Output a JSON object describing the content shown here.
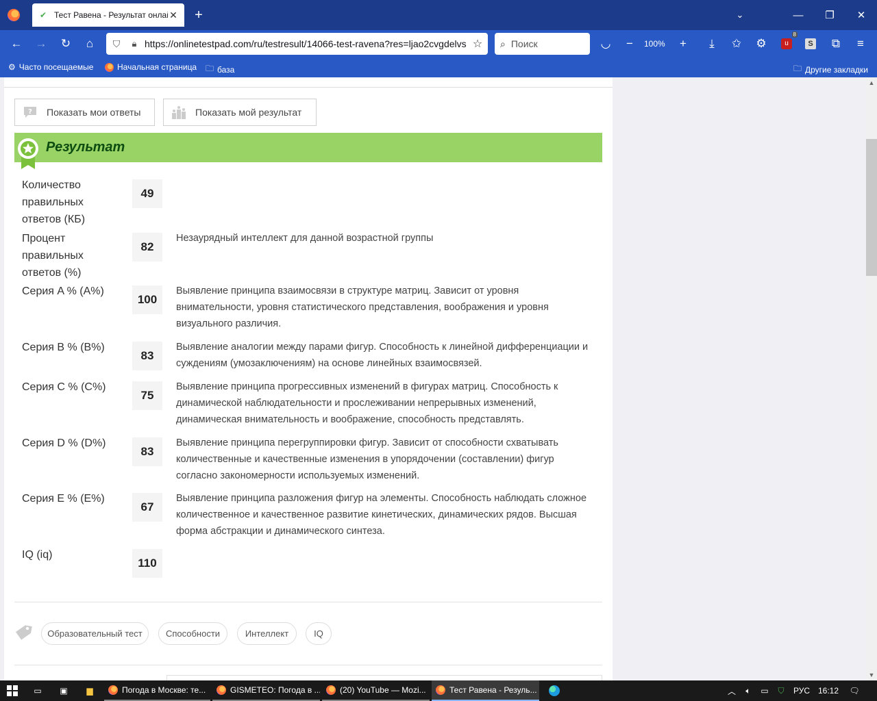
{
  "browser": {
    "tab_title": "Тест Равена - Результат онлайн",
    "url": "https://onlinetestpad.com/ru/testresult/14066-test-ravena?res=ljao2cvgdelvs",
    "search_placeholder": "Поиск",
    "zoom": "100%",
    "extension_badge": "8",
    "bookmarks": [
      "Часто посещаемые",
      "Начальная страница",
      "база"
    ],
    "other_bookmarks": "Другие закладки"
  },
  "page": {
    "show_answers": "Показать мои ответы",
    "show_result": "Показать мой результат",
    "result_title": "Результат",
    "rows": [
      {
        "label": "Количество правильных ответов (КБ)",
        "value": "49",
        "desc": ""
      },
      {
        "label": "Процент правильных ответов (%)",
        "value": "82",
        "desc": "Незаурядный интеллект для данной возрастной группы"
      },
      {
        "label": "Серия A % (A%)",
        "value": "100",
        "desc": "Выявление принципа взаимосвязи в структуре матриц. Зависит от уровня внимательности, уровня статистического представления, воображения и уровня визуального различия."
      },
      {
        "label": "Серия B % (B%)",
        "value": "83",
        "desc": "Выявление аналогии между парами фигур. Способность к линейной дифференциации и суждениям (умозаключениям) на основе линейных взаимосвязей."
      },
      {
        "label": "Серия C % (C%)",
        "value": "75",
        "desc": "Выявление принципа прогрессивных изменений в фигурах матриц. Способность к динамической наблюдательности и прослеживании непрерывных изменений, динамическая внимательность и воображение, способность представлять."
      },
      {
        "label": "Серия D % (D%)",
        "value": "83",
        "desc": "Выявление принципа перегруппировки фигур. Зависит от способности схватывать количественные и качественные изменения в упорядочении (составлении) фигур согласно закономерности используемых изменений."
      },
      {
        "label": "Серия E % (E%)",
        "value": "67",
        "desc": "Выявление принципа разложения фигур на элементы. Способность наблюдать сложное количественное и качественное развитие кинетических, динамических рядов. Высшая форма абстракции и динамического синтеза."
      },
      {
        "label": "IQ (iq)",
        "value": "110",
        "desc": ""
      }
    ],
    "tags": [
      "Образовательный тест",
      "Способности",
      "Интеллект",
      "IQ"
    ]
  },
  "taskbar": {
    "items": [
      "Погода в Москве: те...",
      "GISMETEO: Погода в ...",
      "(20) YouTube — Mozi...",
      "Тест Равена - Резуль..."
    ],
    "language": "РУС",
    "time": "16:12"
  },
  "colors": {
    "titlebar": "#1c3b8a",
    "navbar": "#2859c5",
    "result_green": "#9ad365",
    "result_title": "#0d4d12"
  }
}
